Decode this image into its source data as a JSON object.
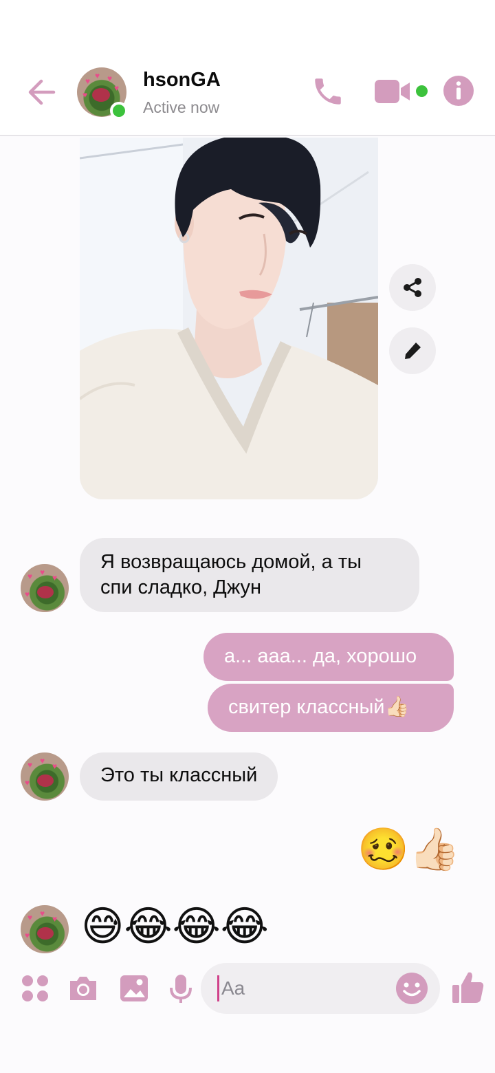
{
  "header": {
    "contact_name": "hsonGA",
    "contact_status": "Active now"
  },
  "messages": [
    {
      "side": "in",
      "text": "Я возвращаюсь домой, а ты спи сладко, Джун"
    },
    {
      "side": "out",
      "text": "а... ааа... да, хорошо"
    },
    {
      "side": "out",
      "text": "свитер классный👍🏻"
    },
    {
      "side": "in",
      "text": "Это ты классный"
    },
    {
      "side": "out",
      "text": "🥴👍🏻"
    },
    {
      "side": "in",
      "text": "😅😂😂😂"
    }
  ],
  "composer": {
    "placeholder": "Aa"
  },
  "colors": {
    "accent": "#d8a3c3",
    "icon_pink": "#d39cbd",
    "online_green": "#3cc23c",
    "incoming_bubble": "#eae8eb"
  },
  "icons": [
    "arrow-left-icon",
    "phone-icon",
    "video-camera-icon",
    "info-icon",
    "share-icon",
    "pencil-icon",
    "apps-grid-icon",
    "camera-icon",
    "image-icon",
    "microphone-icon",
    "smile-icon",
    "thumbs-up-icon"
  ]
}
